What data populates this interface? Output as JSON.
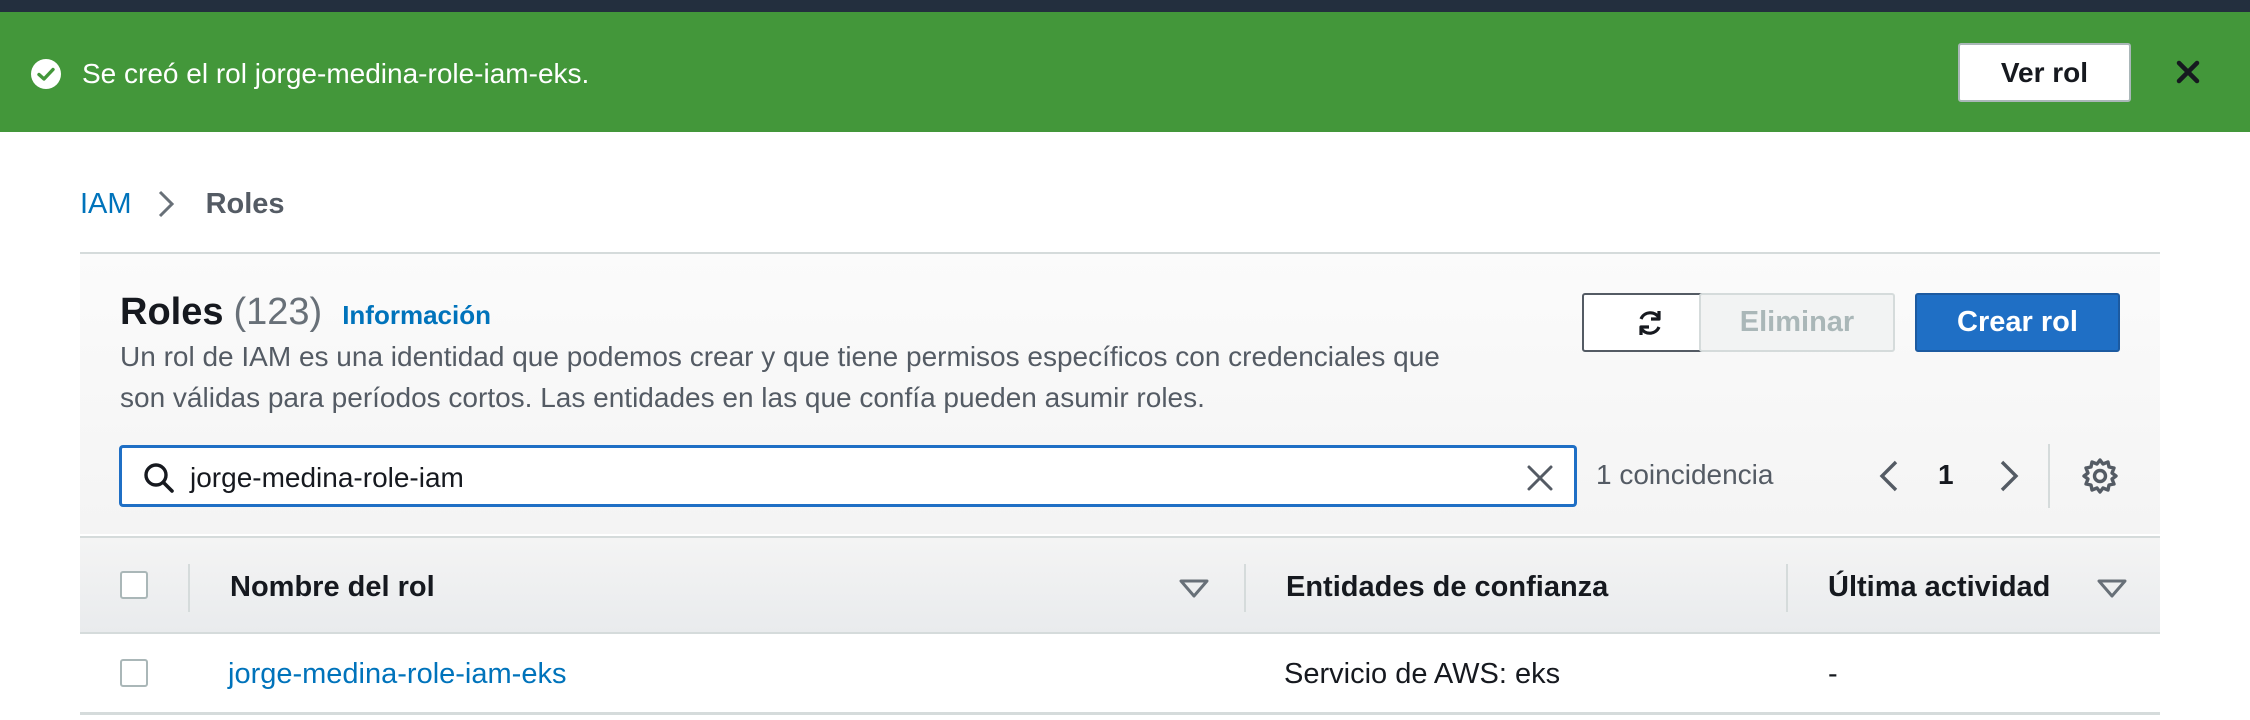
{
  "flash": {
    "message": "Se creó el rol jorge-medina-role-iam-eks.",
    "button_label": "Ver rol",
    "icon": "check-circle-icon",
    "color": "#43973a"
  },
  "breadcrumb": {
    "items": [
      "IAM",
      "Roles"
    ]
  },
  "header": {
    "title": "Roles",
    "count": "(123)",
    "info_link": "Información",
    "description": "Un rol de IAM es una identidad que podemos crear y que tiene permisos específicos con credenciales que son válidas para períodos cortos. Las entidades en las que confía pueden asumir roles.",
    "buttons": {
      "refresh_icon": "refresh-icon",
      "delete_label": "Eliminar",
      "create_label": "Crear rol"
    }
  },
  "search": {
    "value": "jorge-medina-role-iam",
    "matches": "1 coincidencia"
  },
  "pagination": {
    "current_page": "1"
  },
  "table": {
    "columns": [
      "Nombre del rol",
      "Entidades de confianza",
      "Última actividad"
    ],
    "rows": [
      {
        "name": "jorge-medina-role-iam-eks",
        "trusted": "Servicio de AWS: eks",
        "last_activity": "-"
      }
    ]
  },
  "colors": {
    "primary": "#1f6fc5",
    "link": "#0073bb",
    "success": "#43973a"
  }
}
